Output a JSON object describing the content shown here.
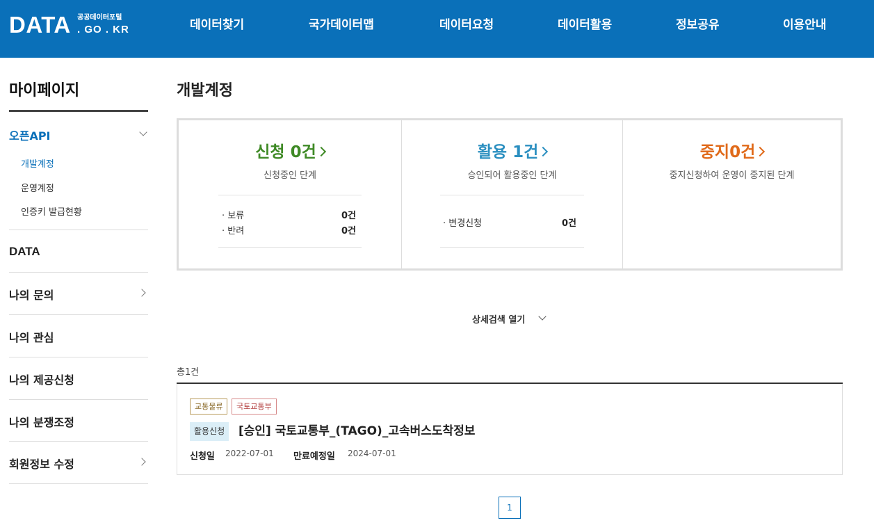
{
  "header": {
    "logo_main": "DATA",
    "logo_sub": "공공데이터포털",
    "logo_domain": ". GO . KR",
    "nav": [
      "데이터찾기",
      "국가데이터맵",
      "데이터요청",
      "데이터활용",
      "정보공유",
      "이용안내"
    ]
  },
  "sidebar": {
    "title": "마이페이지",
    "openapi": {
      "label": "오픈API",
      "subs": [
        "개발계정",
        "운영계정",
        "인증키 발급현황"
      ]
    },
    "menus": [
      "DATA",
      "나의 문의",
      "나의 관심",
      "나의 제공신청",
      "나의 분쟁조정",
      "회원정보 수정"
    ]
  },
  "main": {
    "title": "개발계정",
    "status": {
      "apply": {
        "head": "신청 0건",
        "desc": "신청중인 단계",
        "rows": [
          {
            "label": "· 보류",
            "value": "0건"
          },
          {
            "label": "· 반려",
            "value": "0건"
          }
        ],
        "color": "#3f8a26"
      },
      "use": {
        "head": "활용 1건",
        "desc": "승인되어 활용중인 단계",
        "rows": [
          {
            "label": "· 변경신청",
            "value": "0건"
          }
        ],
        "color": "#2b8fc0"
      },
      "stop": {
        "head": "중지0건",
        "desc": "중지신청하여 운영이 중지된 단계",
        "color": "#e06a1a"
      }
    },
    "detail_search": "상세검색 열기",
    "total": "총1건",
    "items": [
      {
        "tags": [
          "교통물류",
          "국토교통부"
        ],
        "badge": "활용신청",
        "title": "[승인] 국토교통부_(TAGO)_고속버스도착정보",
        "apply_label": "신청일",
        "apply_date": "2022-07-01",
        "end_label": "만료예정일",
        "end_date": "2024-07-01"
      }
    ],
    "pagination": {
      "current": "1"
    }
  },
  "colors": {
    "header_bg": "#0a70b9",
    "accent": "#0a70b9",
    "tag1": "#8a6a2a",
    "tag2": "#b23b3b"
  }
}
